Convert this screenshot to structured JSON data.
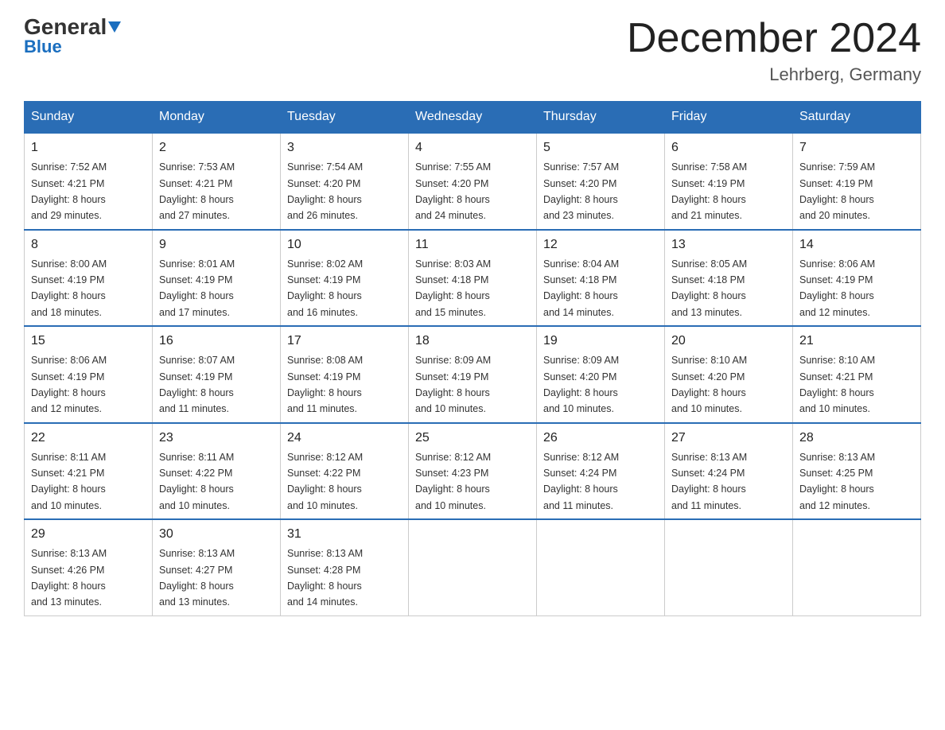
{
  "logo": {
    "general": "General",
    "blue": "Blue",
    "alt": "GeneralBlue logo"
  },
  "title": {
    "month_year": "December 2024",
    "location": "Lehrberg, Germany"
  },
  "days_of_week": [
    "Sunday",
    "Monday",
    "Tuesday",
    "Wednesday",
    "Thursday",
    "Friday",
    "Saturday"
  ],
  "weeks": [
    [
      {
        "day": "1",
        "sunrise": "7:52 AM",
        "sunset": "4:21 PM",
        "daylight": "8 hours and 29 minutes."
      },
      {
        "day": "2",
        "sunrise": "7:53 AM",
        "sunset": "4:21 PM",
        "daylight": "8 hours and 27 minutes."
      },
      {
        "day": "3",
        "sunrise": "7:54 AM",
        "sunset": "4:20 PM",
        "daylight": "8 hours and 26 minutes."
      },
      {
        "day": "4",
        "sunrise": "7:55 AM",
        "sunset": "4:20 PM",
        "daylight": "8 hours and 24 minutes."
      },
      {
        "day": "5",
        "sunrise": "7:57 AM",
        "sunset": "4:20 PM",
        "daylight": "8 hours and 23 minutes."
      },
      {
        "day": "6",
        "sunrise": "7:58 AM",
        "sunset": "4:19 PM",
        "daylight": "8 hours and 21 minutes."
      },
      {
        "day": "7",
        "sunrise": "7:59 AM",
        "sunset": "4:19 PM",
        "daylight": "8 hours and 20 minutes."
      }
    ],
    [
      {
        "day": "8",
        "sunrise": "8:00 AM",
        "sunset": "4:19 PM",
        "daylight": "8 hours and 18 minutes."
      },
      {
        "day": "9",
        "sunrise": "8:01 AM",
        "sunset": "4:19 PM",
        "daylight": "8 hours and 17 minutes."
      },
      {
        "day": "10",
        "sunrise": "8:02 AM",
        "sunset": "4:19 PM",
        "daylight": "8 hours and 16 minutes."
      },
      {
        "day": "11",
        "sunrise": "8:03 AM",
        "sunset": "4:18 PM",
        "daylight": "8 hours and 15 minutes."
      },
      {
        "day": "12",
        "sunrise": "8:04 AM",
        "sunset": "4:18 PM",
        "daylight": "8 hours and 14 minutes."
      },
      {
        "day": "13",
        "sunrise": "8:05 AM",
        "sunset": "4:18 PM",
        "daylight": "8 hours and 13 minutes."
      },
      {
        "day": "14",
        "sunrise": "8:06 AM",
        "sunset": "4:19 PM",
        "daylight": "8 hours and 12 minutes."
      }
    ],
    [
      {
        "day": "15",
        "sunrise": "8:06 AM",
        "sunset": "4:19 PM",
        "daylight": "8 hours and 12 minutes."
      },
      {
        "day": "16",
        "sunrise": "8:07 AM",
        "sunset": "4:19 PM",
        "daylight": "8 hours and 11 minutes."
      },
      {
        "day": "17",
        "sunrise": "8:08 AM",
        "sunset": "4:19 PM",
        "daylight": "8 hours and 11 minutes."
      },
      {
        "day": "18",
        "sunrise": "8:09 AM",
        "sunset": "4:19 PM",
        "daylight": "8 hours and 10 minutes."
      },
      {
        "day": "19",
        "sunrise": "8:09 AM",
        "sunset": "4:20 PM",
        "daylight": "8 hours and 10 minutes."
      },
      {
        "day": "20",
        "sunrise": "8:10 AM",
        "sunset": "4:20 PM",
        "daylight": "8 hours and 10 minutes."
      },
      {
        "day": "21",
        "sunrise": "8:10 AM",
        "sunset": "4:21 PM",
        "daylight": "8 hours and 10 minutes."
      }
    ],
    [
      {
        "day": "22",
        "sunrise": "8:11 AM",
        "sunset": "4:21 PM",
        "daylight": "8 hours and 10 minutes."
      },
      {
        "day": "23",
        "sunrise": "8:11 AM",
        "sunset": "4:22 PM",
        "daylight": "8 hours and 10 minutes."
      },
      {
        "day": "24",
        "sunrise": "8:12 AM",
        "sunset": "4:22 PM",
        "daylight": "8 hours and 10 minutes."
      },
      {
        "day": "25",
        "sunrise": "8:12 AM",
        "sunset": "4:23 PM",
        "daylight": "8 hours and 10 minutes."
      },
      {
        "day": "26",
        "sunrise": "8:12 AM",
        "sunset": "4:24 PM",
        "daylight": "8 hours and 11 minutes."
      },
      {
        "day": "27",
        "sunrise": "8:13 AM",
        "sunset": "4:24 PM",
        "daylight": "8 hours and 11 minutes."
      },
      {
        "day": "28",
        "sunrise": "8:13 AM",
        "sunset": "4:25 PM",
        "daylight": "8 hours and 12 minutes."
      }
    ],
    [
      {
        "day": "29",
        "sunrise": "8:13 AM",
        "sunset": "4:26 PM",
        "daylight": "8 hours and 13 minutes."
      },
      {
        "day": "30",
        "sunrise": "8:13 AM",
        "sunset": "4:27 PM",
        "daylight": "8 hours and 13 minutes."
      },
      {
        "day": "31",
        "sunrise": "8:13 AM",
        "sunset": "4:28 PM",
        "daylight": "8 hours and 14 minutes."
      },
      null,
      null,
      null,
      null
    ]
  ],
  "labels": {
    "sunrise": "Sunrise:",
    "sunset": "Sunset:",
    "daylight": "Daylight:"
  }
}
